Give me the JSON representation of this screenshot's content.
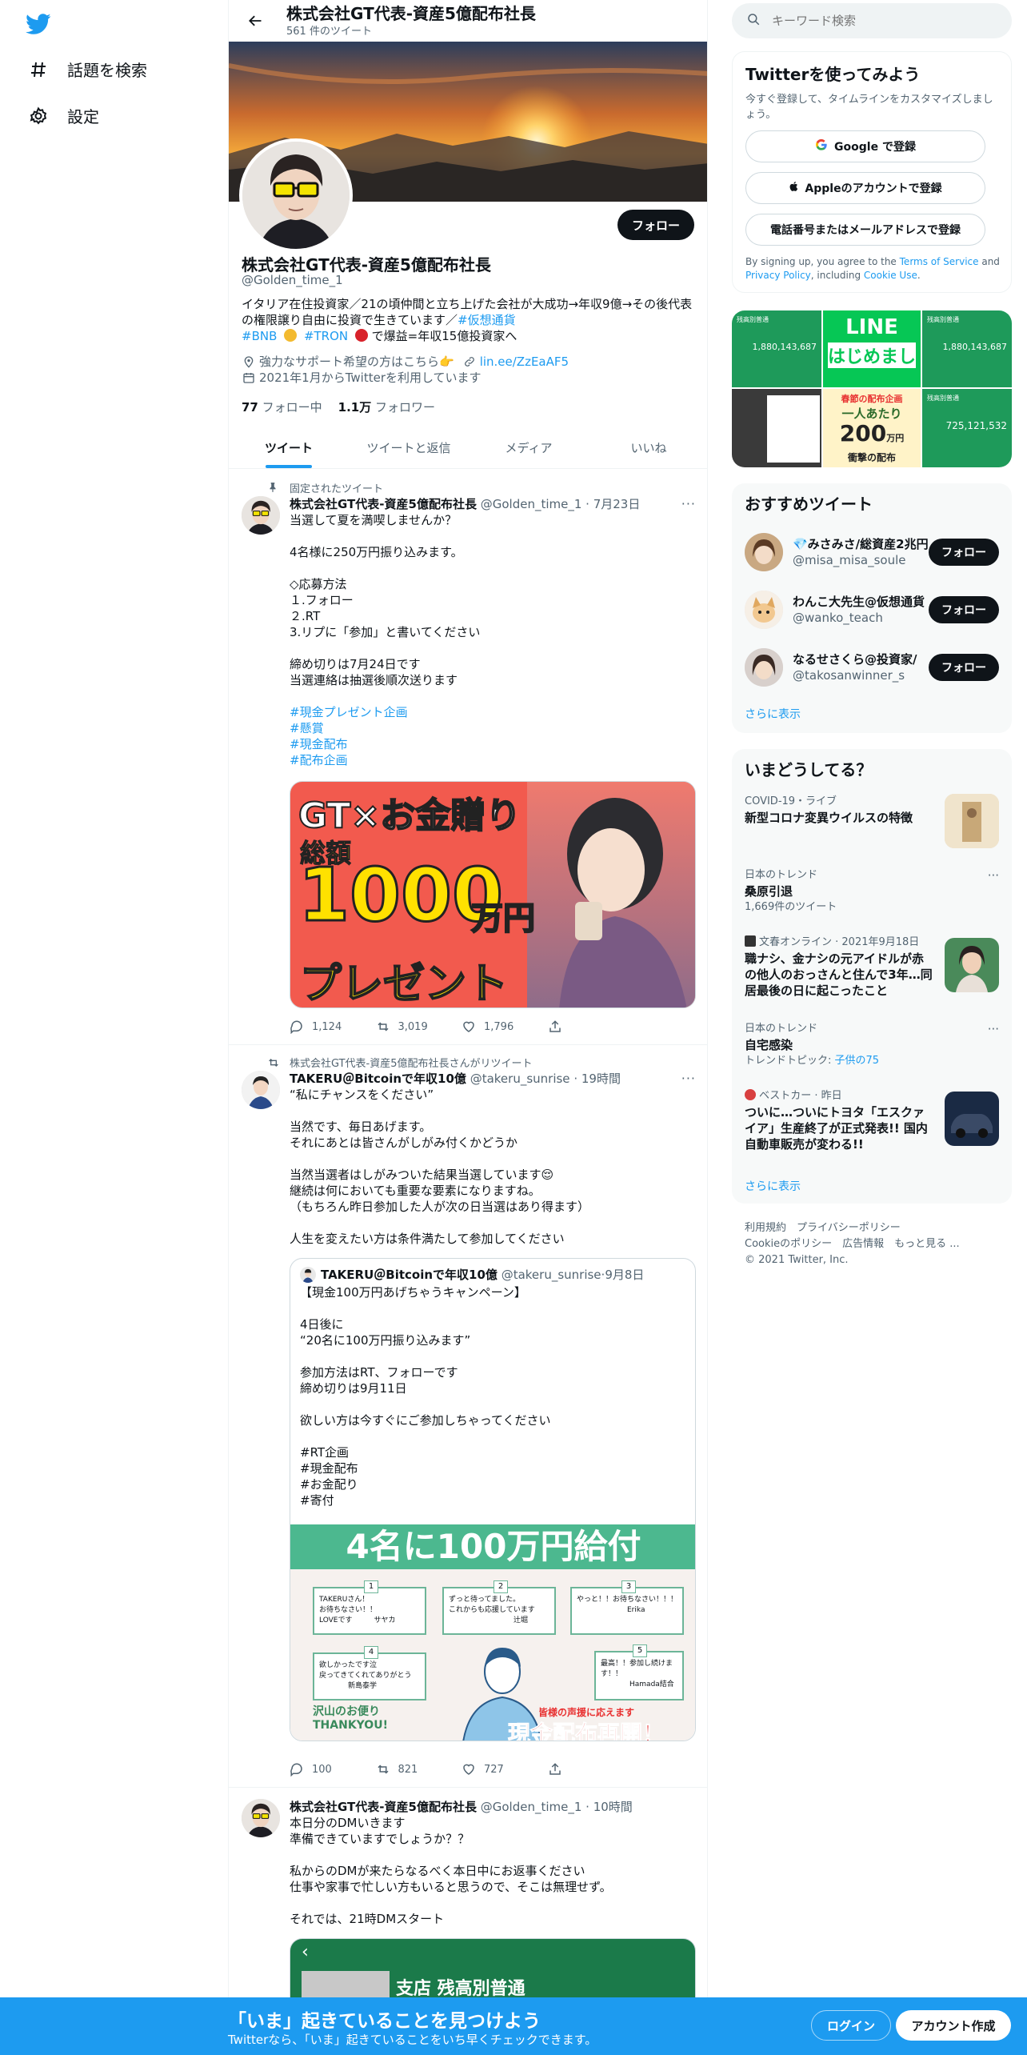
{
  "nav": {
    "explore": "話題を検索",
    "settings": "設定"
  },
  "profile_header": {
    "title": "株式会社GT代表-資産5億配布社長",
    "tweet_count": "561 件のツイート"
  },
  "profile": {
    "follow_label": "フォロー",
    "name": "株式会社GT代表-資産5億配布社長",
    "handle": "@Golden_time_1",
    "bio_line1": "イタリア在住投資家／21の頃仲間と立ち上げた会社が大成功→年収9億→その後代表",
    "bio_line2a": "の権限譲り自由に投資で生きています／",
    "bio_hashtag1": "#仮想通貨",
    "bio_hashtag2": "#BNB",
    "bio_hashtag3": "#TRON",
    "bio_tail": " で爆益=年収15億投資家へ",
    "location": "強力なサポート希望の方はこちら👉",
    "link": "lin.ee/ZzEaAF5",
    "joined": "2021年1月からTwitterを利用しています",
    "following_count": "77",
    "following_label": "フォロー中",
    "followers_count": "1.1万",
    "followers_label": "フォロワー"
  },
  "tabs": [
    {
      "label": "ツイート"
    },
    {
      "label": "ツイートと返信"
    },
    {
      "label": "メディア"
    },
    {
      "label": "いいね"
    }
  ],
  "tweets": [
    {
      "context": "固定されたツイート",
      "name": "株式会社GT代表-資産5億配布社長",
      "handle": "@Golden_time_1",
      "time": "7月23日",
      "text": "当選して夏を満喫しませんか？\n\n4名様に250万円振り込みます。\n\n◇応募方法\n１.フォロー\n２.RT\n3.リプに「参加」と書いてください\n\n締め切りは7月24日です\n当選連絡は抽選後順次送ります",
      "hashtags": [
        "#現金プレゼント企画",
        "#懸賞",
        "#現金配布",
        "#配布企画"
      ],
      "image_text": {
        "line1": "GT×お金贈り",
        "line2": "総額",
        "line3": "1000",
        "line4": "万円",
        "line5": "プレゼント"
      },
      "replies": "1,124",
      "retweets": "3,019",
      "likes": "1,796"
    },
    {
      "context": "株式会社GT代表-資産5億配布社長さんがリツイート",
      "name": "TAKERU＠Bitcoinで年収10億",
      "handle": "@takeru_sunrise",
      "time": "19時間",
      "text": "“私にチャンスをください”\n\n当然です、毎日あげます。\nそれにあとは皆さんがしがみ付くかどうか\n\n当然当選者はしがみついた結果当選しています😌\n継続は何においても重要な要素になりますね。\n（もちろん昨日参加した人が次の日当選はあり得ます）\n\n人生を変えたい方は条件満たして参加してください",
      "quote": {
        "name": "TAKERU＠Bitcoinで年収10億",
        "handle": "@takeru_sunrise",
        "time": "9月8日",
        "text": "【現金100万円あげちゃうキャンペーン】\n\n4日後に\n“20名に100万円振り込みます”\n\n参加方法はRT、フォローです\n締め切りは9月11日\n\n欲しい方は今すぐにご参加しちゃってください\n\n#RT企画\n#現金配布\n#お金配り\n#寄付",
        "image_banner": "4名に100万円給付",
        "notes": [
          {
            "n": "1",
            "text": "TAKERUさん！\nお待ちなさい！！\nLOVEです　　　サヤカ"
          },
          {
            "n": "2",
            "text": "ずっと待ってました。\nこれからも応援しています\n　　　　　　　　　辻堀"
          },
          {
            "n": "3",
            "text": "やっと！！お待ちなさい！！！\n　　　　　　　Erika"
          },
          {
            "n": "4",
            "text": "欲しかったです泣\n戻ってきてくれてありがとう\n　　　　新島泰学"
          },
          {
            "n": "5",
            "text": "最高！！参加し続けます！！\n　　　　Hamada結合"
          }
        ],
        "thanks": "沢山のお便り\nTHANKYOU!",
        "caption_small": "皆様の声援に応えます",
        "caption_big": "現金配布再開！"
      },
      "replies": "100",
      "retweets": "821",
      "likes": "727"
    },
    {
      "name": "株式会社GT代表-資産5億配布社長",
      "handle": "@Golden_time_1",
      "time": "10時間",
      "text": "本日分のDMいきます\n準備できていますでしょうか？？\n\n私からのDMが来たらなるべく本日中にお返事ください\n仕事や家事で忙しい方もいると思うので、そこは無理せず。\n\nそれでは、21時DMスタート",
      "image_text": "支店 残高別普通"
    }
  ],
  "search": {
    "placeholder": "キーワード検索"
  },
  "signin": {
    "title": "Twitterを使ってみよう",
    "subtitle": "今すぐ登録して、タイムラインをカスタマイズしましょう。",
    "google": "Google で登録",
    "apple": "Appleのアカウントで登録",
    "phone": "電話番号またはメールアドレスで登録",
    "terms_prefix": "By signing up, you agree to the ",
    "terms_link": "Terms of Service",
    "terms_and": " and ",
    "privacy_link": "Privacy Policy",
    "terms_mid": ", including ",
    "cookie_link": "Cookie Use",
    "terms_end": "."
  },
  "media_grid": [
    {
      "label": "残高別普通",
      "value": "1,880,143,687"
    },
    {
      "label": "LINE",
      "sub": "はじめまし"
    },
    {
      "label": "残高別普通",
      "value": "1,880,143,687"
    },
    {
      "label": "",
      "value": ""
    },
    {
      "label": "春節の配布企画",
      "sub": "一人あたり",
      "big": "200",
      "unit": "万円",
      "foot": "衝撃の配布"
    },
    {
      "label": "残高別普通",
      "value": "725,121,532"
    }
  ],
  "recommended": {
    "title": "おすすめツイート",
    "more": "さらに表示",
    "follow_label": "フォロー",
    "users": [
      {
        "name": "💎みさみさ/総資産2兆円",
        "handle": "@misa_misa_soule"
      },
      {
        "name": "わんこ大先生@仮想通貨",
        "handle": "@wanko_teach"
      },
      {
        "name": "なるせさくら@投資家/",
        "handle": "@takosanwinner_s"
      }
    ]
  },
  "trends": {
    "title": "いまどうしてる？",
    "more": "さらに表示",
    "items": [
      {
        "category": "COVID-19・ライブ",
        "title": "新型コロナ変異ウイルスの特徴"
      },
      {
        "category": "日本のトレンド",
        "title": "桑原引退",
        "meta": "1,669件のツイート"
      },
      {
        "category": "文春オンライン · 2021年9月18日",
        "title": "職ナシ、金ナシの元アイドルが赤の他人のおっさんと住んで3年…同居最後の日に起こったこと"
      },
      {
        "category": "日本のトレンド",
        "title": "自宅感染",
        "meta_prefix": "トレンドトピック: ",
        "meta_link": "子供の75"
      },
      {
        "category": "ベストカー · 昨日",
        "title": "ついに…ついにトヨタ「エスクァイア」生産終了が正式発表!! 国内自動車販売が変わる!!"
      }
    ]
  },
  "footer": {
    "links1": "利用規約　プライバシーポリシー",
    "links2": "Cookieのポリシー　広告情報　もっと見る ...",
    "copyright": "© 2021 Twitter, Inc."
  },
  "bottombar": {
    "title": "「いま」起きていることを見つけよう",
    "subtitle": "Twitterなら、「いま」起きていることをいち早くチェックできます。",
    "login": "ログイン",
    "signup": "アカウント作成"
  },
  "colors": {
    "accent": "#1d9bf0",
    "text": "#0f1419",
    "muted": "#536471"
  }
}
